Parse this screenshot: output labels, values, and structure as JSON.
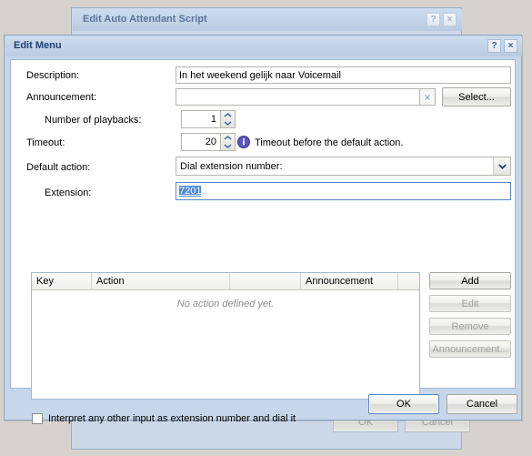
{
  "background_window": {
    "title": "Edit Auto Attendant Script",
    "help_button": "?",
    "close_button": "×",
    "ok_label": "OK",
    "cancel_label": "Cancel"
  },
  "dialog": {
    "title": "Edit Menu",
    "help_button": "?",
    "close_button": "×",
    "fields": {
      "description_label": "Description:",
      "description_value": "In het weekend gelijk naar Voicemail",
      "announcement_label": "Announcement:",
      "announcement_value": "",
      "announcement_clear_icon": "×",
      "announcement_select_label": "Select...",
      "playbacks_label": "Number of playbacks:",
      "playbacks_value": "1",
      "timeout_label": "Timeout:",
      "timeout_value": "20",
      "timeout_hint": "Timeout before the default action.",
      "timeout_hint_icon": "info-icon",
      "default_action_label": "Default action:",
      "default_action_value": "Dial extension number:",
      "extension_label": "Extension:",
      "extension_value": "7201"
    },
    "table": {
      "columns": [
        "Key",
        "Action",
        "",
        "Announcement",
        ""
      ],
      "rows": [],
      "empty_message": "No action defined yet."
    },
    "side_buttons": [
      {
        "label": "Add",
        "enabled": true
      },
      {
        "label": "Edit",
        "enabled": false
      },
      {
        "label": "Remove",
        "enabled": false
      },
      {
        "label": "Announcement...",
        "enabled": false
      }
    ],
    "checkbox": {
      "label": "Interpret any other input as extension number and dial it",
      "checked": false
    },
    "footer": {
      "ok_label": "OK",
      "cancel_label": "Cancel"
    }
  },
  "colors": {
    "dialog_chrome": "#c7d6e9",
    "titlebar_text_active": "#1e3f73",
    "titlebar_text_inactive": "#5a7599",
    "selection_blue": "#4d8ad8",
    "focus_border": "#5b86c4",
    "info_icon": "#5b55c0",
    "disabled_text": "#a0a09d"
  }
}
